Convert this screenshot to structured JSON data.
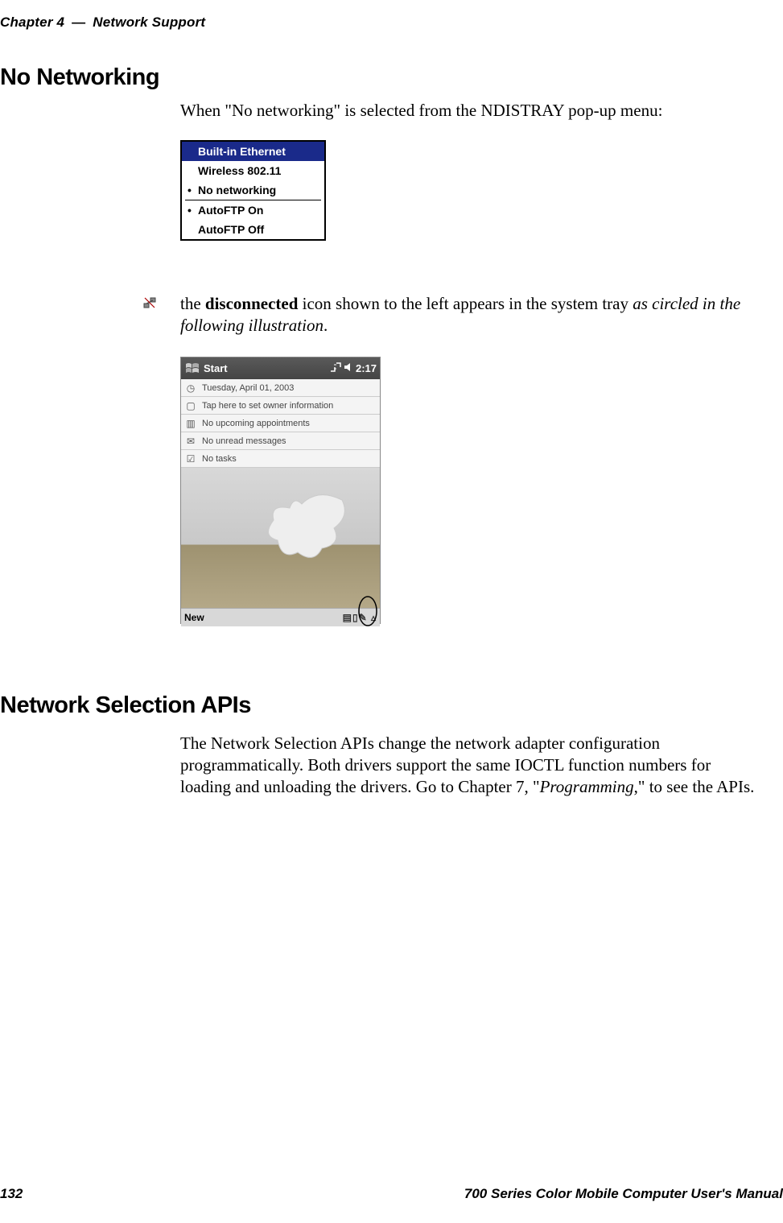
{
  "running_head": {
    "chapter": "Chapter 4",
    "dash": "—",
    "title": "Network Support"
  },
  "headings": {
    "h1": "No Networking",
    "h2": "Network Selection APIs"
  },
  "para1": "When \"No networking\" is selected from the NDISTRAY pop-up menu:",
  "ndistray_menu": {
    "items": [
      {
        "label": "Built-in Ethernet",
        "selected": true,
        "bullet": false
      },
      {
        "label": "Wireless 802.11",
        "selected": false,
        "bullet": false
      },
      {
        "label": "No networking",
        "selected": false,
        "bullet": true
      }
    ],
    "items2": [
      {
        "label": "AutoFTP On",
        "bullet": true
      },
      {
        "label": "AutoFTP Off",
        "bullet": false
      }
    ]
  },
  "icon_para": {
    "pre": "the ",
    "bold": "disconnected",
    "mid": " icon shown to the left appears in the system tray ",
    "ital": "as circled in the following illustration",
    "post": "."
  },
  "pda": {
    "title": "Start",
    "time": "2:17",
    "rows": [
      {
        "icon": "clock-icon",
        "text": "Tuesday, April 01, 2003"
      },
      {
        "icon": "owner-icon",
        "text": "Tap here to set owner information"
      },
      {
        "icon": "calendar-icon",
        "text": "No upcoming appointments"
      },
      {
        "icon": "mail-icon",
        "text": "No unread messages"
      },
      {
        "icon": "tasks-icon",
        "text": "No tasks"
      }
    ],
    "taskbar_label": "New"
  },
  "para2": {
    "t1": "The Network Selection APIs change the network adapter configuration programmatically. Both drivers support the same IOCTL function numbers for loading and unloading the drivers. Go to Chapter 7, \"",
    "ital": "Programming",
    "t2": ",\" to see the APIs."
  },
  "footer": {
    "page": "132",
    "book": "700 Series Color Mobile Computer User's Manual"
  }
}
